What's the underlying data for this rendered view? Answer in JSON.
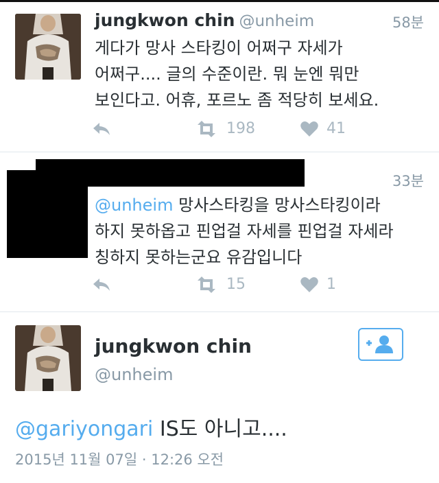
{
  "tweets": [
    {
      "name": "jungkwon chin",
      "handle": "@unheim",
      "time": "58분",
      "lines": [
        "게다가 망사 스타킹이 어쩌구 자세가",
        "어쩌구.... 글의 수준이란. 뭐 눈엔 뭐만",
        "보인다고. 어휴, 포르노 좀 적당히 보세요."
      ],
      "retweets": "198",
      "likes": "41"
    },
    {
      "time": "33분",
      "mention": "@unheim",
      "lines": [
        "망사스타킹을 망사스타킹이라",
        "하지 못하옵고 핀업걸 자세를 핀업걸 자세라",
        "칭하지 못하는군요 유감입니다"
      ],
      "retweets": "15",
      "likes": "1"
    }
  ],
  "detail": {
    "name": "jungkwon chin",
    "handle": "@unheim",
    "mention": "@gariyongari",
    "text": " IS도 아니고....",
    "meta": "2015년 11월 07일 · 12:26 오전"
  },
  "icons": {
    "reply": "reply-icon",
    "retweet": "retweet-icon",
    "like": "heart-icon",
    "follow": "follow-user-icon"
  },
  "colors": {
    "link": "#55acee",
    "muted": "#8899a6",
    "action": "#aab8c2"
  }
}
